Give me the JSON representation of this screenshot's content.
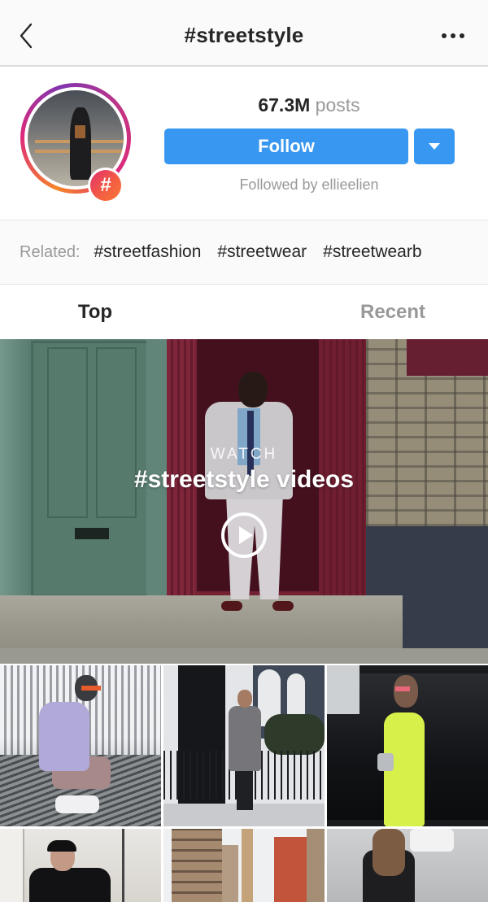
{
  "header": {
    "title": "#streetstyle",
    "back_icon": "chevron-left-icon",
    "more_icon": "more-horizontal-icon"
  },
  "profile": {
    "posts_count": "67.3M",
    "posts_label": "posts",
    "follow_label": "Follow",
    "dropdown_icon": "caret-down-icon",
    "followed_by": "Followed by ellieelien",
    "badge_glyph": "#",
    "accent_color": "#3897f0"
  },
  "related": {
    "label": "Related:",
    "tags": [
      "#streetfashion",
      "#streetwear",
      "#streetwearb"
    ]
  },
  "tabs": [
    {
      "label": "Top",
      "active": true
    },
    {
      "label": "Recent",
      "active": false
    }
  ],
  "video_feature": {
    "kicker": "WATCH",
    "title": "#streetstyle videos",
    "play_icon": "play-circle-icon"
  },
  "grid": {
    "posts": [
      {
        "description": "Man in lavender sweatshirt crouching on metal grating"
      },
      {
        "description": "Man in grey coat in front of black door"
      },
      {
        "description": "Woman in neon yellow dress by black SUV"
      },
      {
        "description": "Man in black cap and jacket"
      },
      {
        "description": "City buildings street view"
      },
      {
        "description": "Woman in black leather jacket on street"
      }
    ]
  }
}
